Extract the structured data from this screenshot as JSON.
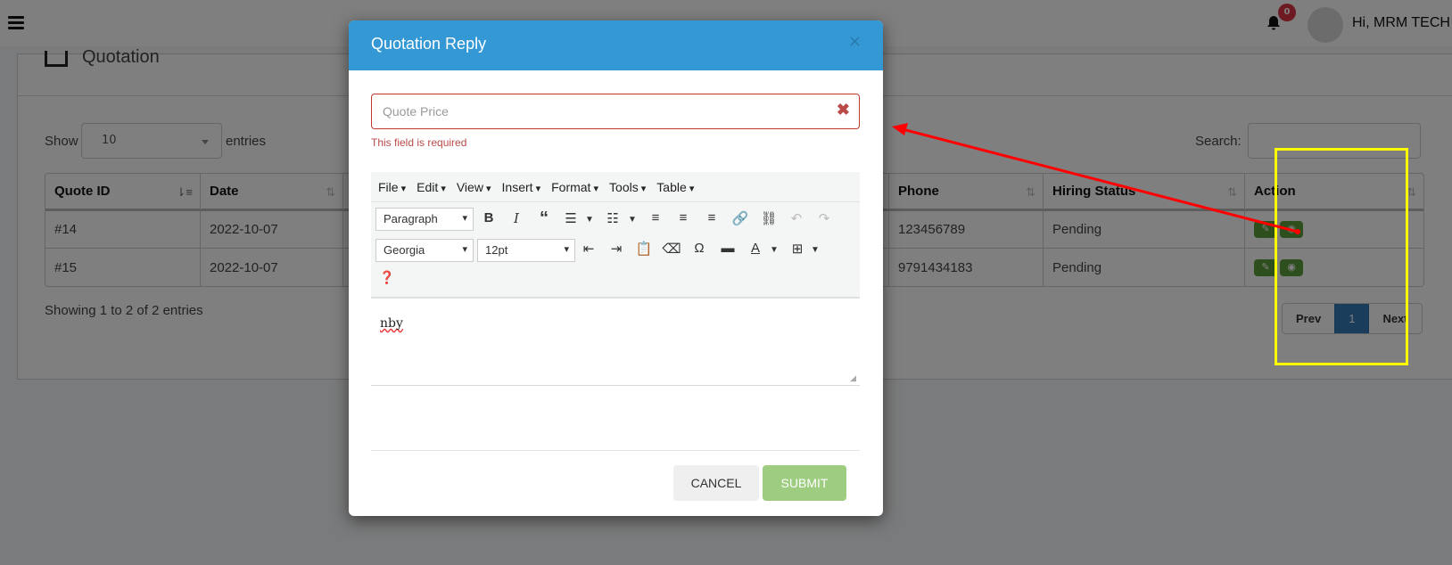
{
  "header": {
    "user_greeting": "Hi, MRM TECH",
    "notification_count": "0"
  },
  "page": {
    "title": "Quotation",
    "show_label": "Show",
    "page_length": "10",
    "entries_label": "entries",
    "search_label": "Search:",
    "search_value": "",
    "info": "Showing 1 to 2 of 2 entries"
  },
  "table": {
    "columns": [
      {
        "label": "Quote ID"
      },
      {
        "label": "Date"
      },
      {
        "label": ""
      },
      {
        "label": "Phone"
      },
      {
        "label": "Hiring Status"
      },
      {
        "label": "Action"
      }
    ],
    "rows": [
      {
        "id": "#14",
        "date": "2022-10-07",
        "phone": "123456789",
        "status": "Pending"
      },
      {
        "id": "#15",
        "date": "2022-10-07",
        "phone": "9791434183",
        "status": "Pending"
      }
    ]
  },
  "pagination": {
    "prev": "Prev",
    "current": "1",
    "next": "Next"
  },
  "modal": {
    "title": "Quotation Reply",
    "close_glyph": "×",
    "price_placeholder": "Quote Price",
    "price_value": "",
    "error_text": "This field is required",
    "menu": [
      "File",
      "Edit",
      "View",
      "Insert",
      "Format",
      "Tools",
      "Table"
    ],
    "block_format": "Paragraph",
    "font_family": "Georgia",
    "font_size": "12pt",
    "content": "nby",
    "cancel_label": "CANCEL",
    "submit_label": "SUBMIT"
  },
  "colors": {
    "modal_header": "#3498d4",
    "error": "#b94a48",
    "action_button": "#5a9c3a",
    "submit_button": "#9ecd82",
    "annotation_box": "#ffff00",
    "annotation_arrow": "#ff0000"
  }
}
